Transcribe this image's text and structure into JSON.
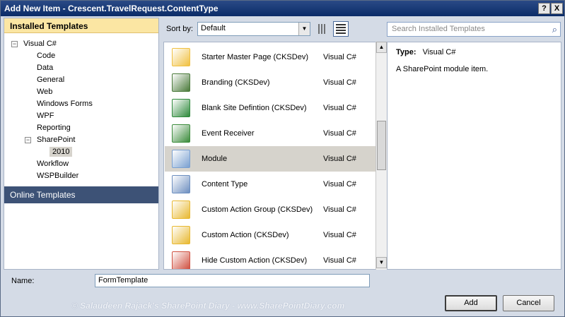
{
  "window": {
    "title": "Add New Item - Crescent.TravelRequest.ContentType",
    "help_label": "?",
    "close_label": "X"
  },
  "left_panel": {
    "header": "Installed Templates",
    "root": "Visual C#",
    "items": [
      "Code",
      "Data",
      "General",
      "Web",
      "Windows Forms",
      "WPF",
      "Reporting"
    ],
    "sharepoint": "SharePoint",
    "sharepoint_child": "2010",
    "after_items": [
      "Workflow",
      "WSPBuilder"
    ],
    "online": "Online Templates",
    "expand_minus": "−"
  },
  "toolbar": {
    "sort_label": "Sort by:",
    "sort_value": "Default",
    "search_placeholder": "Search Installed Templates"
  },
  "templates": [
    {
      "name": "Starter Master Page (CKSDev)",
      "lang": "Visual C#",
      "icon": "master-page-icon",
      "color": "#f0c040"
    },
    {
      "name": "Branding (CKSDev)",
      "lang": "Visual C#",
      "icon": "brush-icon",
      "color": "#4a7a3a"
    },
    {
      "name": "Blank Site Defintion (CKSDev)",
      "lang": "Visual C#",
      "icon": "site-definition-icon",
      "color": "#2f8a3c"
    },
    {
      "name": "Event Receiver",
      "lang": "Visual C#",
      "icon": "event-receiver-icon",
      "color": "#3c8c3c"
    },
    {
      "name": "Module",
      "lang": "Visual C#",
      "icon": "module-icon",
      "color": "#7aa0d0"
    },
    {
      "name": "Content Type",
      "lang": "Visual C#",
      "icon": "content-type-icon",
      "color": "#6d8fc0"
    },
    {
      "name": "Custom Action Group (CKSDev)",
      "lang": "Visual C#",
      "icon": "custom-action-group-icon",
      "color": "#e8b830"
    },
    {
      "name": "Custom Action (CKSDev)",
      "lang": "Visual C#",
      "icon": "custom-action-icon",
      "color": "#e8b830"
    },
    {
      "name": "Hide Custom Action (CKSDev)",
      "lang": "Visual C#",
      "icon": "hide-custom-action-icon",
      "color": "#d05040"
    }
  ],
  "selected_index": 4,
  "details": {
    "type_label": "Type:",
    "type_value": "Visual C#",
    "description": "A SharePoint module item."
  },
  "bottom": {
    "name_label": "Name:",
    "name_value": "FormTemplate",
    "watermark": "© Salaudeen Rajack's SharePoint Diary - www.SharePointDiary.com",
    "add_label": "Add",
    "cancel_label": "Cancel"
  }
}
